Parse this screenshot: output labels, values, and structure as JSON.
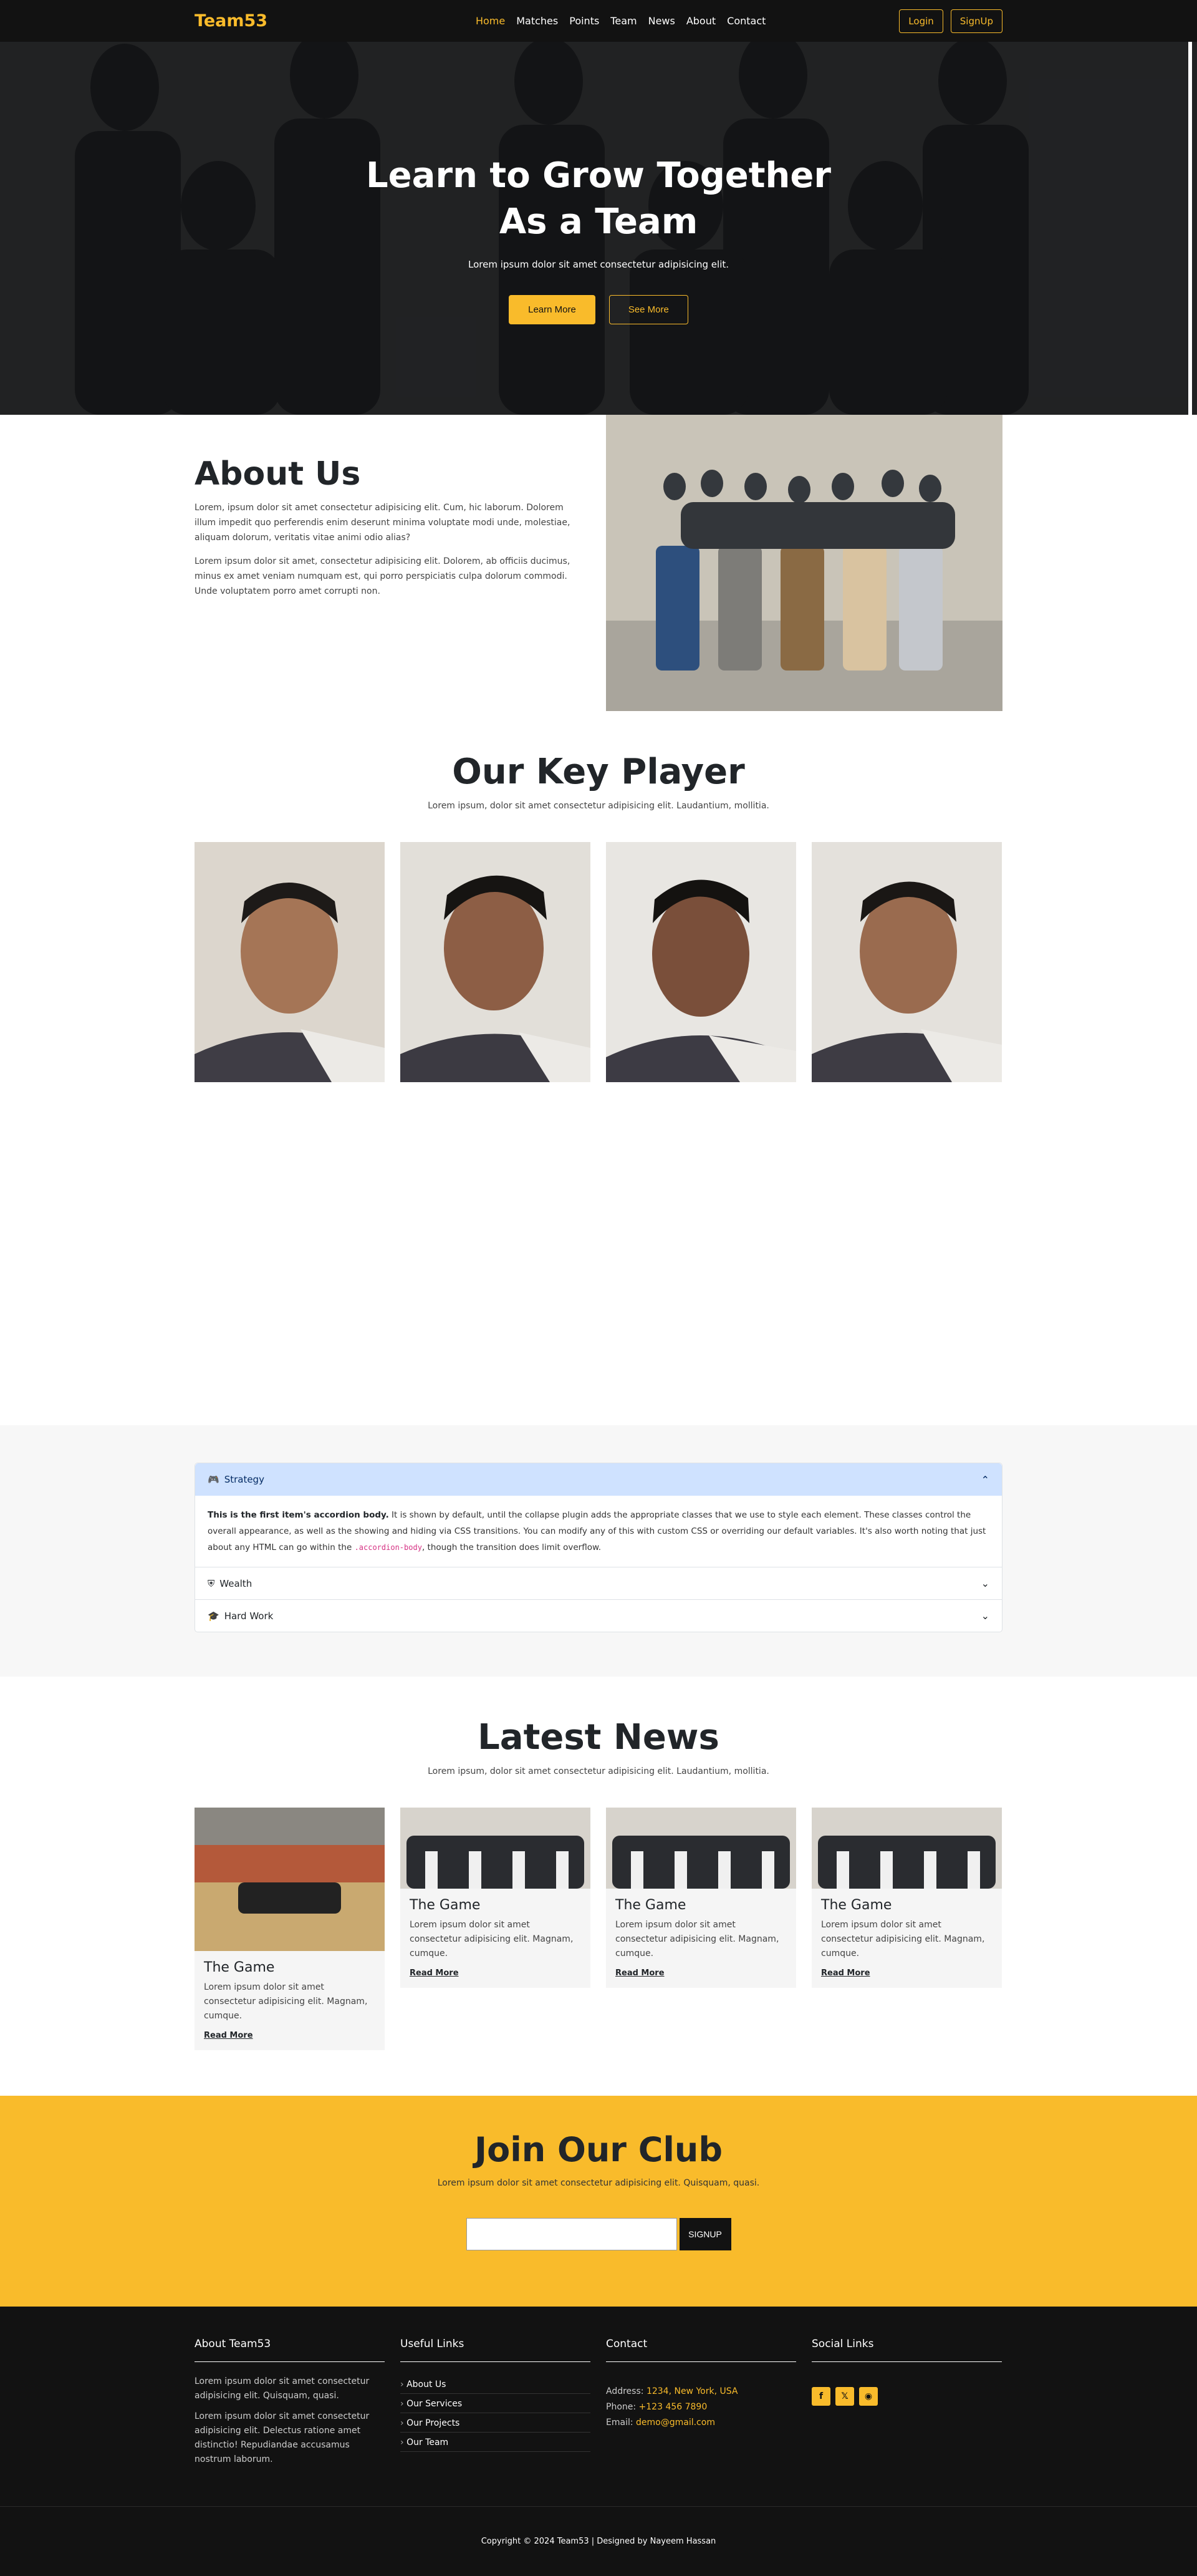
{
  "brand": "Team53",
  "nav": {
    "items": [
      "Home",
      "Matches",
      "Points",
      "Team",
      "News",
      "About",
      "Contact"
    ],
    "login": "Login",
    "signup": "SignUp"
  },
  "hero": {
    "title": "Learn to Grow Together As a Team",
    "subtitle": "Lorem ipsum dolor sit amet consectetur adipisicing elit.",
    "learn_more": "Learn More",
    "see_more": "See More"
  },
  "about": {
    "title": "About Us",
    "p1": "Lorem, ipsum dolor sit amet consectetur adipisicing elit. Cum, hic laborum. Dolorem illum impedit quo perferendis enim deserunt minima voluptate modi unde, molestiae, aliquam dolorum, veritatis vitae animi odio alias?",
    "p2": "Lorem ipsum dolor sit amet, consectetur adipisicing elit. Dolorem, ab officiis ducimus, minus ex amet veniam numquam est, qui porro perspiciatis culpa dolorum commodi. Unde voluptatem porro amet corrupti non."
  },
  "players": {
    "title": "Our Key Player",
    "subtitle": "Lorem ipsum, dolor sit amet consectetur adipisicing elit. Laudantium, mollitia."
  },
  "accordion": {
    "items": [
      {
        "label": "Strategy",
        "icon": "gamepad-icon"
      },
      {
        "label": "Wealth",
        "icon": "shield-icon"
      },
      {
        "label": "Hard Work",
        "icon": "graduation-cap-icon"
      }
    ],
    "body_bold": "This is the first item's accordion body.",
    "body_text": " It is shown by default, until the collapse plugin adds the appropriate classes that we use to style each element. These classes control the overall appearance, as well as the showing and hiding via CSS transitions. You can modify any of this with custom CSS or overriding our default variables. It's also worth noting that just about any HTML can go within the ",
    "body_code": ".accordion-body",
    "body_end": ", though the transition does limit overflow."
  },
  "news": {
    "title": "Latest News",
    "subtitle": "Lorem ipsum, dolor sit amet consectetur adipisicing elit. Laudantium, mollitia.",
    "cards": [
      {
        "title": "The Game",
        "text": "Lorem ipsum dolor sit amet consectetur adipisicing elit. Magnam, cumque.",
        "link": "Read More"
      },
      {
        "title": "The Game",
        "text": "Lorem ipsum dolor sit amet consectetur adipisicing elit. Magnam, cumque.",
        "link": "Read More"
      },
      {
        "title": "The Game",
        "text": "Lorem ipsum dolor sit amet consectetur adipisicing elit. Magnam, cumque.",
        "link": "Read More"
      },
      {
        "title": "The Game",
        "text": "Lorem ipsum dolor sit amet consectetur adipisicing elit. Magnam, cumque.",
        "link": "Read More"
      }
    ]
  },
  "join": {
    "title": "Join Our Club",
    "subtitle": "Lorem ipsum dolor sit amet consectetur adipisicing elit. Quisquam, quasi.",
    "button": "SIGNUP"
  },
  "footer": {
    "about_title": "About Team53",
    "about_p1": "Lorem ipsum dolor sit amet consectetur adipisicing elit. Quisquam, quasi.",
    "about_p2": "Lorem ipsum dolor sit amet consectetur adipisicing elit. Delectus ratione amet distinctio! Repudiandae accusamus nostrum laborum.",
    "links_title": "Useful Links",
    "links": [
      "About Us",
      "Our Services",
      "Our Projects",
      "Our Team"
    ],
    "contact_title": "Contact",
    "address_label": "Address:",
    "address": "1234, New York, USA",
    "phone_label": "Phone:",
    "phone": "+123 456 7890",
    "email_label": "Email:",
    "email": "demo@gmail.com",
    "social_title": "Social Links",
    "socials": [
      "facebook-icon",
      "x-icon",
      "instagram-icon"
    ],
    "copyright": "Copyright © 2024 Team53 | Designed by Nayeem Hassan"
  },
  "colors": {
    "accent": "#f9bb2b",
    "dark": "#121212",
    "accordion_active": "#cfe2ff"
  }
}
